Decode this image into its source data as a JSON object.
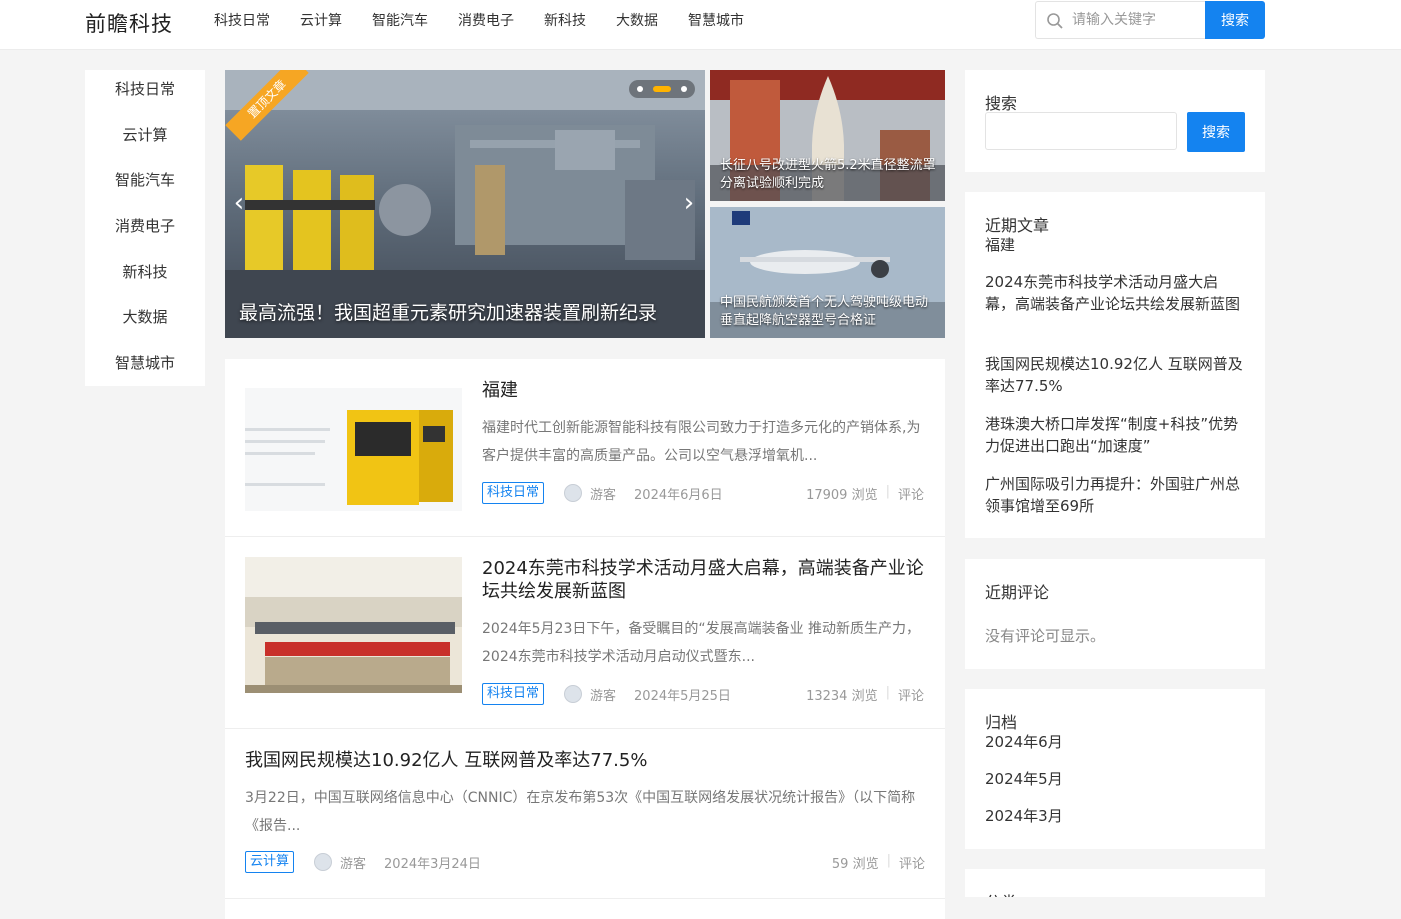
{
  "header": {
    "logo": "前瞻科技",
    "nav": [
      "科技日常",
      "云计算",
      "智能汽车",
      "消费电子",
      "新科技",
      "大数据",
      "智慧城市"
    ],
    "search_placeholder": "请输入关键字",
    "search_button": "搜索"
  },
  "left_nav": [
    "科技日常",
    "云计算",
    "智能汽车",
    "消费电子",
    "新科技",
    "大数据",
    "智慧城市"
  ],
  "slider": {
    "ribbon": "置顶文章",
    "caption": "最高流强！我国超重元素研究加速器装置刷新纪录",
    "prev_icon": "chevron-left-icon",
    "next_icon": "chevron-right-icon"
  },
  "side_cards": [
    {
      "caption": "长征八号改进型火箭5.2米直径整流罩分离试验顺利完成"
    },
    {
      "caption": "中国民航颁发首个无人驾驶吨级电动垂直起降航空器型号合格证"
    }
  ],
  "articles": [
    {
      "title": "福建",
      "excerpt": "福建时代工创新能源智能科技有限公司致力于打造多元化的产销体系,为客户提供丰富的高质量产品。公司以空气悬浮增氧机...",
      "tag": "科技日常",
      "author": "游客",
      "date": "2024年6月6日",
      "views": "17909 浏览",
      "comments": "评论"
    },
    {
      "title": "2024东莞市科技学术活动月盛大启幕，高端装备产业论坛共绘发展新蓝图",
      "excerpt": "2024年5月23日下午，备受瞩目的“发展高端装备业 推动新质生产力，2024东莞市科技学术活动月启动仪式暨东...",
      "tag": "科技日常",
      "author": "游客",
      "date": "2024年5月25日",
      "views": "13234 浏览",
      "comments": "评论"
    },
    {
      "title": "我国网民规模达10.92亿人 互联网普及率达77.5%",
      "excerpt": "3月22日，中国互联网络信息中心（CNNIC）在京发布第53次《中国互联网络发展状况统计报告》（以下简称《报告...",
      "tag": "云计算",
      "author": "游客",
      "date": "2024年3月24日",
      "views": "59 浏览",
      "comments": "评论"
    }
  ],
  "sidebar": {
    "search": {
      "title": "搜索",
      "button": "搜索"
    },
    "recent_posts": {
      "title": "近期文章",
      "items": [
        "福建",
        "2024东莞市科技学术活动月盛大启幕，高端装备产业论坛共绘发展新蓝图",
        "我国网民规模达10.92亿人 互联网普及率达77.5%",
        "港珠澳大桥口岸发挥“制度+科技”优势 力促进出口跑出“加速度”",
        "广州国际吸引力再提升：外国驻广州总领事馆增至69所"
      ]
    },
    "recent_comments": {
      "title": "近期评论",
      "empty": "没有评论可显示。"
    },
    "archives": {
      "title": "归档",
      "items": [
        "2024年6月",
        "2024年5月",
        "2024年3月"
      ]
    },
    "categories": {
      "title": "分类"
    }
  },
  "colors": {
    "accent": "#1483f0",
    "ribbon": "#f6a623",
    "dot_active": "#ffb300"
  }
}
